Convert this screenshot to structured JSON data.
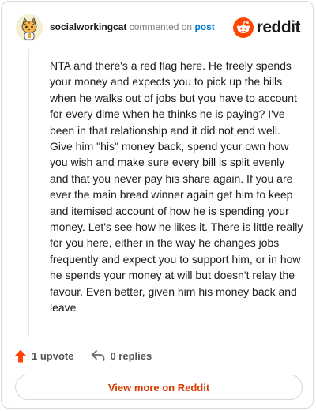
{
  "header": {
    "username": "socialworkingcat",
    "action_text": "commented on",
    "post_link": "post",
    "brand_name": "reddit",
    "brand_color": "#ff4500"
  },
  "comment": {
    "text": "NTA and there's a red flag here. He freely spends your money and expects you to pick up the bills when he walks out of jobs but you have to account for every dime when he thinks he is paying? I've been in that relationship and it did not end well. Give him \"his\" money back, spend your own how you wish and make sure every bill is split evenly and that you never pay his share again. If you are ever the main bread winner again get him to keep and itemised account of how he is spending your money. Let's see how he likes it. There is little really for you here, either in the way he changes jobs frequently and expect you to support him, or in how he spends your money at will but doesn't relay the favour. Even better, given him his money back and leave"
  },
  "actions": {
    "upvote_label": "1 upvote",
    "replies_label": "0 replies",
    "upvote_icon": "upvote-arrow-icon",
    "reply_icon": "reply-arrow-icon",
    "upvote_color": "#ff4500"
  },
  "footer": {
    "view_more_label": "View more on Reddit",
    "view_more_color": "#d93a00"
  }
}
